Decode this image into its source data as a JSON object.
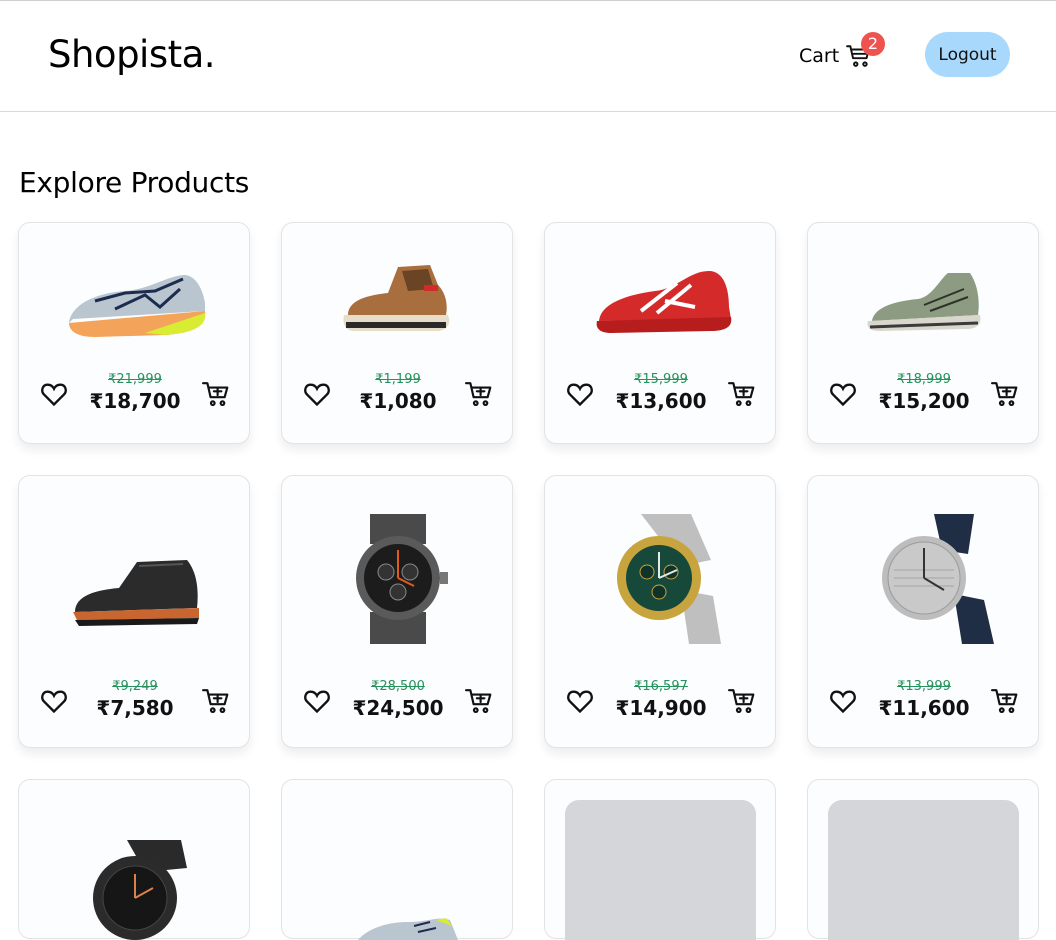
{
  "header": {
    "logo": "Shopista.",
    "cart_label": "Cart",
    "cart_count": "2",
    "logout_label": "Logout"
  },
  "page_title": "Explore Products",
  "currency_symbol": "₹",
  "colors": {
    "badge": "#ef5350",
    "logout_bg": "#a8d8fb",
    "old_price": "#25935b",
    "placeholder": "#d4d6d9"
  },
  "icons": {
    "cart": "shopping-cart-icon",
    "wishlist": "heart-outline-icon",
    "add_to_cart": "cart-plus-icon"
  },
  "products": [
    {
      "kind": "running shoe",
      "old_price": "₹21,999",
      "price": "₹18,700"
    },
    {
      "kind": "hiking boot",
      "old_price": "₹1,199",
      "price": "₹1,080"
    },
    {
      "kind": "tennis shoe",
      "old_price": "₹15,999",
      "price": "₹13,600"
    },
    {
      "kind": "sneaker",
      "old_price": "₹18,999",
      "price": "₹15,200"
    },
    {
      "kind": "leather boot",
      "old_price": "₹9,249",
      "price": "₹7,580"
    },
    {
      "kind": "chronograph watch",
      "old_price": "₹28,500",
      "price": "₹24,500"
    },
    {
      "kind": "two-tone watch",
      "old_price": "₹16,597",
      "price": "₹14,900"
    },
    {
      "kind": "leather strap watch",
      "old_price": "₹13,999",
      "price": "₹11,600"
    },
    {
      "kind": "black watch"
    },
    {
      "kind": "running shoe"
    },
    {
      "kind": "loading"
    },
    {
      "kind": "loading"
    }
  ]
}
